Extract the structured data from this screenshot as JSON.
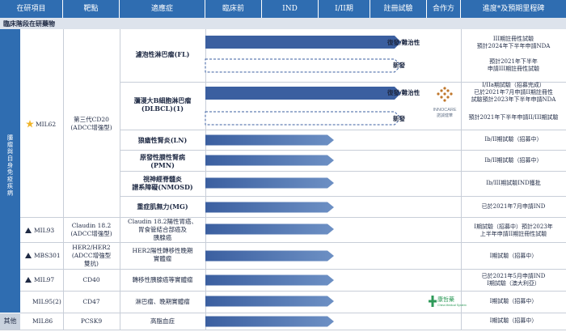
{
  "header": {
    "product": "在研項目",
    "target": "靶點",
    "indication": "適應症",
    "preclinical": "臨床前",
    "ind": "IND",
    "phase": "I/II期",
    "registration": "註冊試驗",
    "partner": "合作方",
    "progress": "進度*及預期里程碑"
  },
  "section_title": "臨床階段在研藥物",
  "left_category": "腫瘤與自身免疫疾病",
  "left_other": "其他",
  "colors": {
    "header": "#2f6db1",
    "bar": "#3b5fa0",
    "bar_light": "#6d90c4",
    "star": "#f0b429"
  },
  "rows": [
    {
      "id": "r_fl",
      "indication": "濾泡性淋巴瘤(FL)",
      "bar": "solid",
      "stage": 1.0,
      "status": "復發/難治性",
      "progress": "III期註冊性試驗\n預計2024年下半年申請NDA"
    },
    {
      "id": "r_fl2",
      "indication": "",
      "bar": "dashed",
      "stage": 1.0,
      "status": "新發",
      "progress": "預計2021年下半年\n申請III期註冊性試驗"
    },
    {
      "id": "r_dlbcl",
      "indication": "瀰漫大B細胞淋巴瘤\n(DLBCL)(1)",
      "bar": "solid",
      "stage": 1.0,
      "status": "復發/難治性",
      "progress": "I/IIa期試驗（招募完成）\n已於2021年7月申請II期註冊性\n試驗預計2023年下半年申請NDA"
    },
    {
      "id": "r_dlbcl2",
      "indication": "",
      "bar": "dashed",
      "stage": 1.0,
      "status": "新發",
      "progress": "預計2021年下半年申請II/III期試驗"
    },
    {
      "id": "r_ln",
      "indication": "狼瘡性腎炎(LN)",
      "bar": "light",
      "stage": 0.75,
      "status": "",
      "progress": "Ib/II期試驗（招募中）"
    },
    {
      "id": "r_pmn",
      "indication": "原發性膜性腎病\n(PMN)",
      "bar": "light",
      "stage": 0.75,
      "status": "",
      "progress": "Ib/II期試驗（招募中）"
    },
    {
      "id": "r_nmosd",
      "indication": "視神經脊髓炎\n譜系障礙(NMOSD)",
      "bar": "light",
      "stage": 0.75,
      "status": "",
      "progress": "Ib/III期試驗IND獲批"
    },
    {
      "id": "r_mg",
      "indication": "重症肌無力(MG)",
      "bar": "light",
      "stage": 0.75,
      "status": "",
      "progress": "已於2021年7月申請IND"
    },
    {
      "id": "r_mil93",
      "indication": "Claudin 18.2陽性胃癌、\n胃食管結合部癌及\n胰腺癌",
      "bar": "light",
      "stage": 0.75,
      "status": "",
      "progress": "I期試驗（招募中）預計2023年\n上半年申請II期註冊性試驗"
    },
    {
      "id": "r_mbs301",
      "indication": "HER2陽性轉移性晚期\n實體瘤",
      "bar": "light",
      "stage": 0.75,
      "status": "",
      "progress": "I期試驗（招募中）"
    },
    {
      "id": "r_mil97",
      "indication": "轉移性胰腺癌等實體瘤",
      "bar": "light",
      "stage": 0.75,
      "status": "",
      "progress": "已於2021年5月申請IND\nI期試驗（澳大利亞）"
    },
    {
      "id": "r_mil95",
      "indication": "淋巴瘤、晚期實體瘤",
      "bar": "light",
      "stage": 0.75,
      "status": "",
      "progress": "I期試驗（招募中）"
    },
    {
      "id": "r_mil86",
      "indication": "高脂血症",
      "bar": "light",
      "stage": 0.75,
      "status": "",
      "progress": "I期試驗（招募中）"
    }
  ],
  "products": {
    "mil62": "MIL62",
    "mil93": "MIL93",
    "mbs301": "MBS301",
    "mil97": "MIL97",
    "mil95": "MIL95(2)",
    "mil86": "MIL86"
  },
  "targets": {
    "mil62": "第三代CD20\n(ADCC增強型)",
    "mil93": "Claudin 18.2\n(ADCC增強型)",
    "mbs301": "HER2/HER2\n(ADCC增強型\n雙抗)",
    "mil97": "CD40",
    "mil95": "CD47",
    "mil86": "PCSK9"
  },
  "partners": {
    "innocare_en": "INNOCARE",
    "innocare_cn": "諾誠健華",
    "rx": "康哲藥",
    "rx_en": "China Medical System"
  }
}
